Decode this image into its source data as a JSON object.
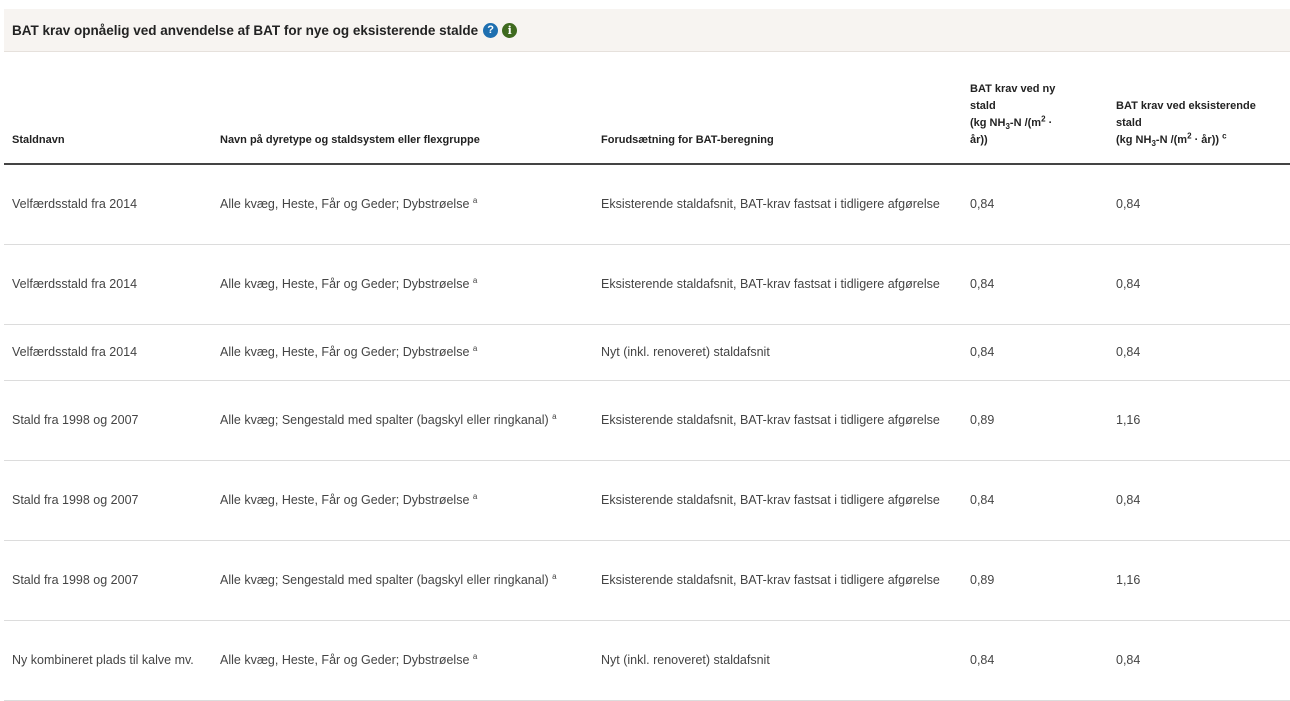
{
  "panel": {
    "title": "BAT krav opnåelig ved anvendelse af BAT for nye og eksisterende stalde",
    "icons": [
      "help-icon",
      "info-icon"
    ],
    "help_glyph": "?",
    "info_glyph": "i"
  },
  "table": {
    "headers": {
      "staldnavn": "Staldnavn",
      "dyretype": "Navn på dyretype og staldsystem eller flexgruppe",
      "forudsaetning": "Forudsætning for BAT-beregning",
      "ny_line1": "BAT krav ved ny",
      "ny_line2": "stald",
      "ny_unit_a": "(kg NH",
      "ny_unit_sub": "3",
      "ny_unit_b": "-N /(m",
      "ny_unit_sup": "2",
      "ny_unit_c": " ·",
      "ny_line4": "år))",
      "eks_line1": "BAT krav ved eksisterende",
      "eks_line2": "stald",
      "eks_unit_a": "(kg NH",
      "eks_unit_sub": "3",
      "eks_unit_b": "-N /(m",
      "eks_unit_sup": "2",
      "eks_unit_c": " · år))",
      "eks_note": "c"
    },
    "rows": [
      {
        "staldnavn": "Velfærdsstald fra 2014",
        "dyretype": "Alle kvæg, Heste, Får og Geder; Dybstrøelse",
        "note": "a",
        "forudsaetning": "Eksisterende staldafsnit, BAT-krav fastsat i tidligere afgørelse",
        "ny": "0,84",
        "eks": "0,84"
      },
      {
        "staldnavn": "Velfærdsstald fra 2014",
        "dyretype": "Alle kvæg, Heste, Får og Geder; Dybstrøelse",
        "note": "a",
        "forudsaetning": "Eksisterende staldafsnit, BAT-krav fastsat i tidligere afgørelse",
        "ny": "0,84",
        "eks": "0,84"
      },
      {
        "staldnavn": "Velfærdsstald fra 2014",
        "dyretype": "Alle kvæg, Heste, Får og Geder; Dybstrøelse",
        "note": "a",
        "forudsaetning": "Nyt (inkl. renoveret) staldafsnit",
        "ny": "0,84",
        "eks": "0,84"
      },
      {
        "staldnavn": "Stald fra 1998 og 2007",
        "dyretype": "Alle kvæg; Sengestald med spalter (bagskyl eller ringkanal)",
        "note": "a",
        "forudsaetning": "Eksisterende staldafsnit, BAT-krav fastsat i tidligere afgørelse",
        "ny": "0,89",
        "eks": "1,16"
      },
      {
        "staldnavn": "Stald fra 1998 og 2007",
        "dyretype": "Alle kvæg, Heste, Får og Geder; Dybstrøelse",
        "note": "a",
        "forudsaetning": "Eksisterende staldafsnit, BAT-krav fastsat i tidligere afgørelse",
        "ny": "0,84",
        "eks": "0,84"
      },
      {
        "staldnavn": "Stald fra 1998 og 2007",
        "dyretype": "Alle kvæg; Sengestald med spalter (bagskyl eller ringkanal)",
        "note": "a",
        "forudsaetning": "Eksisterende staldafsnit, BAT-krav fastsat i tidligere afgørelse",
        "ny": "0,89",
        "eks": "1,16"
      },
      {
        "staldnavn": "Ny kombineret plads til kalve mv.",
        "dyretype": "Alle kvæg, Heste, Får og Geder; Dybstrøelse",
        "note": "a",
        "forudsaetning": "Nyt (inkl. renoveret) staldafsnit",
        "ny": "0,84",
        "eks": "0,84"
      }
    ]
  }
}
